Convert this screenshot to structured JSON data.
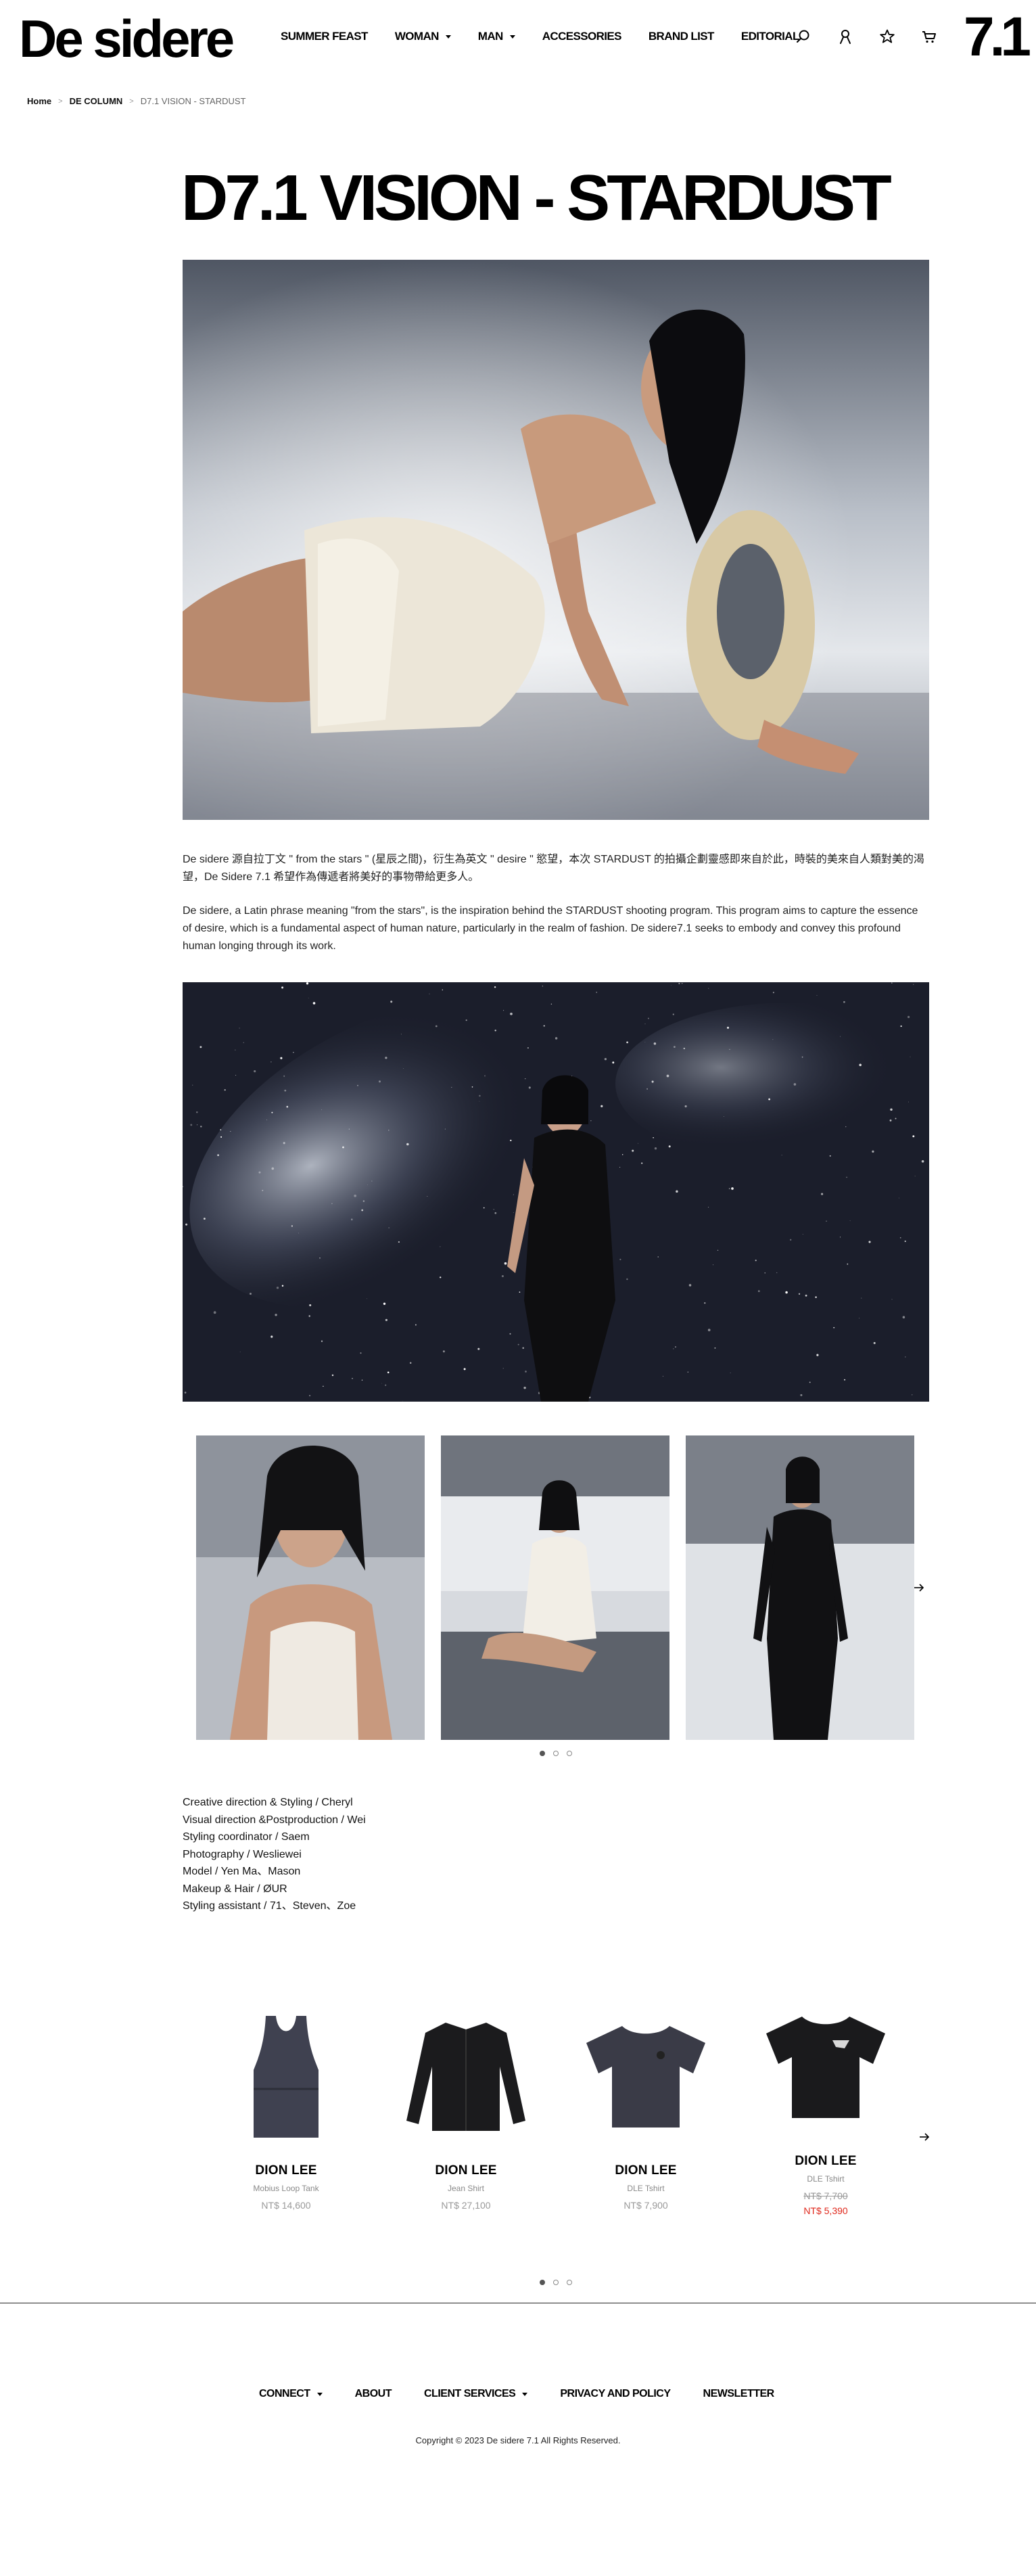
{
  "header": {
    "logo": "De sidere",
    "brand_mark": "7.1",
    "nav": [
      {
        "label": "SUMMER FEAST",
        "dropdown": false
      },
      {
        "label": "WOMAN",
        "dropdown": true
      },
      {
        "label": "MAN",
        "dropdown": true
      },
      {
        "label": "ACCESSORIES",
        "dropdown": false
      },
      {
        "label": "BRAND LIST",
        "dropdown": false
      },
      {
        "label": "EDITORIAL",
        "dropdown": false
      }
    ],
    "icons": [
      "search-icon",
      "account-icon",
      "wishlist-star-icon",
      "cart-icon"
    ]
  },
  "breadcrumb": {
    "home": "Home",
    "section": "DE COLUMN",
    "current": "D7.1 VISION - STARDUST"
  },
  "article": {
    "title": "D7.1 VISION - STARDUST",
    "paragraph_zh": "De sidere 源自拉丁文 \" from the stars \" (星辰之間)，衍生為英文 \" desire \" 慾望，本次 STARDUST 的拍攝企劃靈感即來自於此，時裝的美來自人類對美的渴望，De Sidere 7.1 希望作為傳遞者將美好的事物帶給更多人。",
    "paragraph_en": "De sidere, a Latin phrase meaning \"from the stars\", is the inspiration behind the STARDUST shooting program. This program aims to capture the essence of desire, which is a fundamental aspect of human nature, particularly in the realm of fashion. De sidere7.1 seeks to embody and convey this profound human longing through its work.",
    "credits": [
      "Creative direction & Styling / Cheryl",
      "Visual direction &Postproduction /  Wei",
      "Styling coordinator / Saem",
      "Photography /  Wesliewei",
      "Model /  Yen Ma、Mason",
      "Makeup & Hair /  ØUR",
      "Styling assistant /  71、Steven、Zoe"
    ]
  },
  "products": [
    {
      "brand": "DION LEE",
      "name": "Mobius Loop Tank",
      "price": "NT$ 14,600",
      "sale_price": ""
    },
    {
      "brand": "DION LEE",
      "name": "Jean Shirt",
      "price": "NT$ 27,100",
      "sale_price": ""
    },
    {
      "brand": "DION LEE",
      "name": "DLE Tshirt",
      "price": "NT$ 7,900",
      "sale_price": ""
    },
    {
      "brand": "DION LEE",
      "name": "DLE Tshirt",
      "price": "NT$ 7,700",
      "sale_price": "NT$ 5,390"
    }
  ],
  "footer": {
    "nav": [
      {
        "label": "CONNECT",
        "dropdown": true
      },
      {
        "label": "ABOUT",
        "dropdown": false
      },
      {
        "label": "CLIENT SERVICES",
        "dropdown": true
      },
      {
        "label": "PRIVACY AND POLICY",
        "dropdown": false
      },
      {
        "label": "NEWSLETTER",
        "dropdown": false
      }
    ],
    "copyright": "Copyright © 2023 De sidere 7.1 All Rights Reserved."
  },
  "colors": {
    "text": "#111111",
    "muted": "#888888",
    "sale": "#e0281c"
  }
}
